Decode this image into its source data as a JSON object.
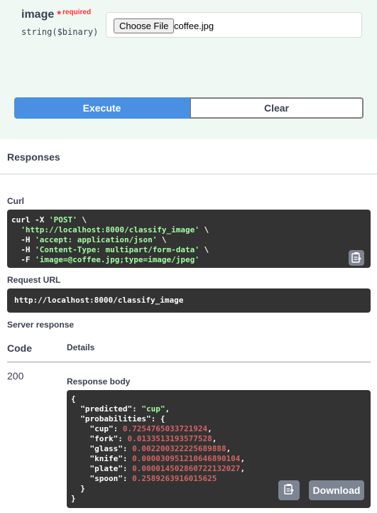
{
  "param": {
    "name": "image",
    "required_star": "*",
    "required_label": "required",
    "type": "string($binary)",
    "file_button": "Choose File",
    "file_name": "coffee.jpg"
  },
  "buttons": {
    "execute": "Execute",
    "clear": "Clear"
  },
  "responses": {
    "title": "Responses",
    "curl_label": "Curl",
    "curl_lines": [
      {
        "pre": "curl -X ",
        "str": "'POST'",
        "post": " \\"
      },
      {
        "pre": "  ",
        "str": "'http://localhost:8000/classify_image'",
        "post": " \\"
      },
      {
        "pre": "  -H ",
        "str": "'accept: application/json'",
        "post": " \\"
      },
      {
        "pre": "  -H ",
        "str": "'Content-Type: multipart/form-data'",
        "post": " \\"
      },
      {
        "pre": "  -F ",
        "str": "'image=@coffee.jpg;type=image/jpeg'",
        "post": ""
      }
    ],
    "request_url_label": "Request URL",
    "request_url": "http://localhost:8000/classify_image",
    "server_response_label": "Server response",
    "col_code": "Code",
    "col_details": "Details",
    "status_code": "200",
    "body_label": "Response body",
    "download_label": "Download"
  },
  "response_body": {
    "predicted_key": "\"predicted\"",
    "predicted_value": "\"cup\"",
    "probabilities_key": "\"probabilities\"",
    "probabilities": [
      {
        "key": "\"cup\"",
        "value": "0.7254765033721924"
      },
      {
        "key": "\"fork\"",
        "value": "0.0133513193577528"
      },
      {
        "key": "\"glass\"",
        "value": "0.002200322225689888"
      },
      {
        "key": "\"knife\"",
        "value": "0.000030951210646890104"
      },
      {
        "key": "\"plate\"",
        "value": "0.000014502860722132027"
      },
      {
        "key": "\"spoon\"",
        "value": "0.2589263916015625"
      }
    ]
  },
  "colors": {
    "execute_blue": "#4990e2",
    "code_bg": "#333333",
    "string_green": "#a2fca2",
    "number_red": "#d36363",
    "required_red": "#ff3030",
    "section_tint": "#f0f8f4"
  },
  "icons": {
    "copy": "clipboard-icon"
  }
}
